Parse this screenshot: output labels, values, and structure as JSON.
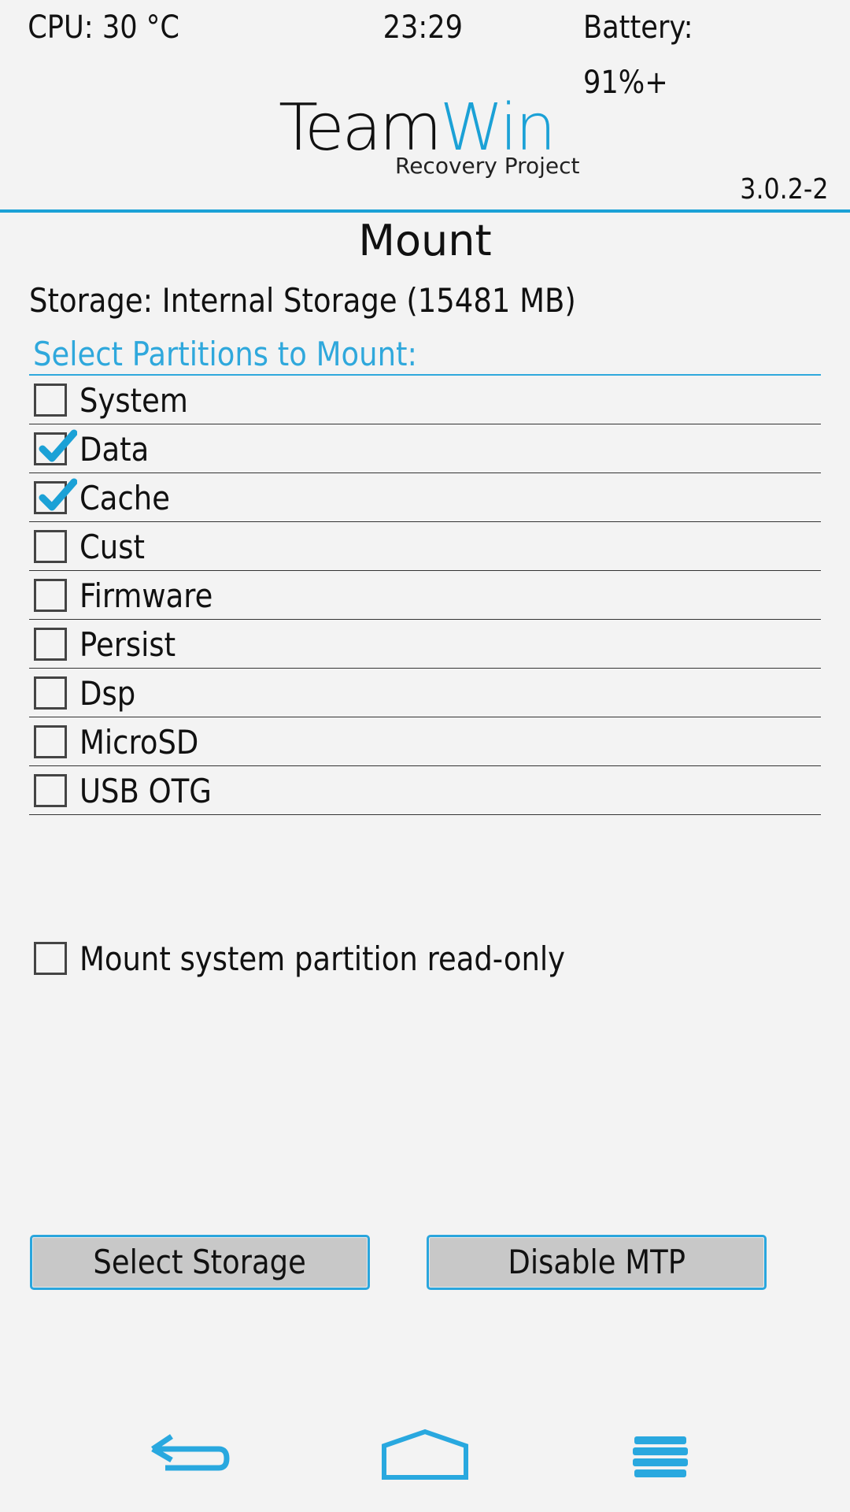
{
  "status_bar": {
    "cpu": "CPU: 30 °C",
    "time": "23:29",
    "battery": "Battery: 91%+"
  },
  "logo": {
    "team": "Team",
    "win": "Win",
    "subtitle": "Recovery Project",
    "version": "3.0.2-2"
  },
  "page": {
    "title": "Mount",
    "storage": "Storage: Internal Storage (15481 MB)",
    "section_header": "Select Partitions to Mount:"
  },
  "partitions": [
    {
      "label": "System",
      "checked": false
    },
    {
      "label": "Data",
      "checked": true
    },
    {
      "label": "Cache",
      "checked": true
    },
    {
      "label": "Cust",
      "checked": false
    },
    {
      "label": "Firmware",
      "checked": false
    },
    {
      "label": "Persist",
      "checked": false
    },
    {
      "label": "Dsp",
      "checked": false
    },
    {
      "label": "MicroSD",
      "checked": false
    },
    {
      "label": "USB OTG",
      "checked": false
    }
  ],
  "readonly_option": {
    "label": "Mount system partition read-only",
    "checked": false
  },
  "buttons": {
    "select_storage": "Select Storage",
    "disable_mtp": "Disable MTP"
  },
  "nav": {
    "back_icon": "back-arrow-icon",
    "home_icon": "home-icon",
    "menu_icon": "menu-icon"
  },
  "colors": {
    "accent": "#1ba1d6",
    "background": "#f3f3f3",
    "button_fill": "#c8c8c8"
  }
}
